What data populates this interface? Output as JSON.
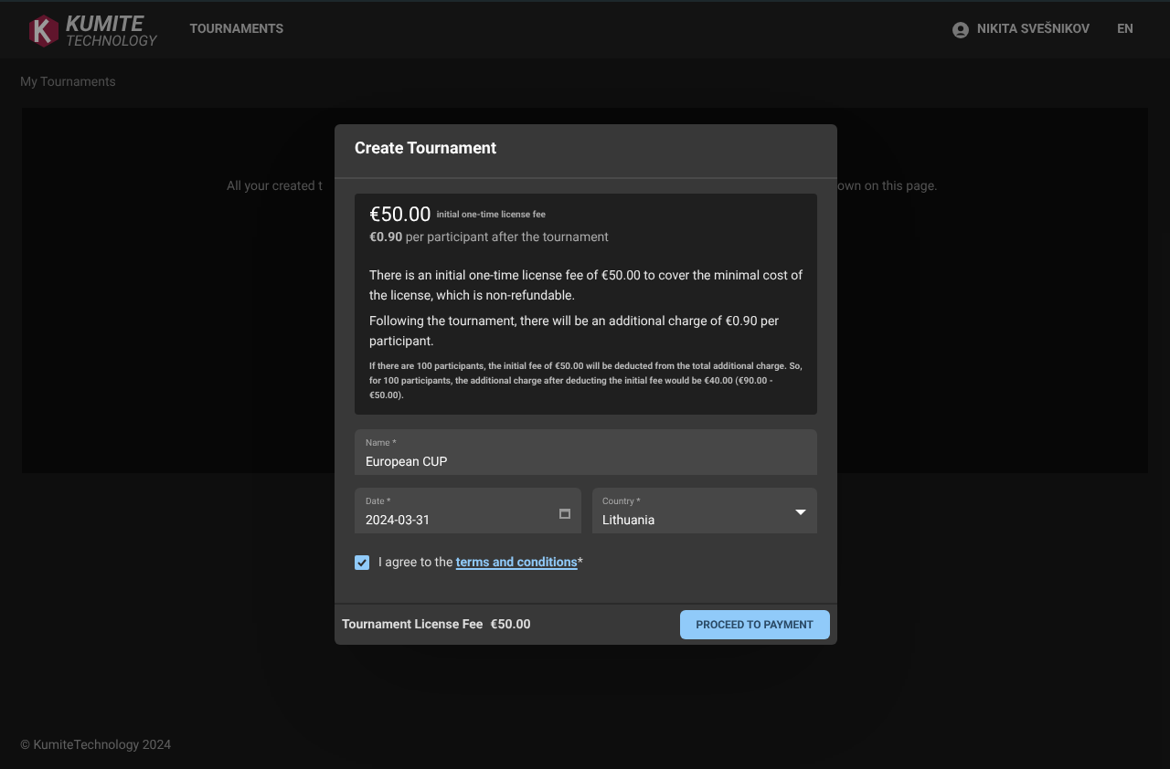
{
  "header": {
    "logo": {
      "title": "KUMITE",
      "subtitle": "TECHNOLOGY"
    },
    "nav": [
      {
        "label": "TOURNAMENTS"
      }
    ],
    "user": "NIKITA SVEŠNIKOV",
    "language": "EN"
  },
  "breadcrumb": "My Tournaments",
  "background_text": {
    "left": "All your created t",
    "right": "own on this page."
  },
  "footer": "© KumiteTechnology 2024",
  "dialog": {
    "title": "Create Tournament",
    "price": "€50.00",
    "price_note": "initial one-time license fee",
    "per_participant": {
      "amount": "€0.90",
      "text": "per participant after the tournament"
    },
    "paragraphs": [
      "There is an initial one-time license fee of €50.00 to cover the minimal cost of the license, which is non-refundable.",
      "Following the tournament, there will be an additional charge of €0.90 per participant."
    ],
    "fine_print": "If there are 100 participants, the initial fee of €50.00 will be deducted from the total additional charge. So, for 100 participants, the additional charge after deducting the initial fee would be €40.00 (€90.00 - €50.00).",
    "fields": [
      {
        "label": "Name *",
        "value": "European CUP",
        "kind": "text"
      },
      {
        "label": "Date *",
        "value": "2024-03-31",
        "kind": "date"
      },
      {
        "label": "Country *",
        "value": "Lithuania",
        "kind": "select"
      }
    ],
    "agree": {
      "checked": true,
      "text": "I agree to the",
      "link": "terms and conditions",
      "required": "*"
    },
    "fee_label": "Tournament License Fee",
    "fee_value": "€50.00",
    "button": "PROCEED TO PAYMENT"
  }
}
